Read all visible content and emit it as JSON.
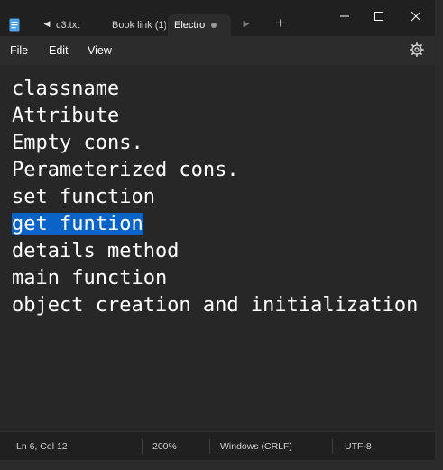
{
  "titlebar": {
    "app_icon": "notepad-icon",
    "tabs": [
      {
        "label": "c3.txt",
        "active": false
      },
      {
        "label": "Book link (1).",
        "active": false
      },
      {
        "label": "Electro",
        "active": true,
        "unsaved": true
      }
    ],
    "scroll_left_icon": "triangle-left-icon",
    "scroll_right_icon": "triangle-right-icon",
    "new_tab_label": "+",
    "window_controls": [
      "minimize-icon",
      "maximize-icon",
      "close-icon"
    ]
  },
  "menu": {
    "file": "File",
    "edit": "Edit",
    "view": "View",
    "settings_icon": "gear-icon"
  },
  "editor": {
    "lines": [
      "classname",
      "Attribute",
      "Empty cons.",
      "Perameterized cons.",
      "set function",
      "get funtion",
      "details method",
      "main function",
      "object creation and initialization"
    ],
    "selected_line": 6,
    "selection_color": "#0a64c8"
  },
  "status": {
    "position": "Ln 6, Col 12",
    "zoom": "200%",
    "line_ending": "Windows (CRLF)",
    "encoding": "UTF-8"
  },
  "colors": {
    "background": "#272727",
    "titlebar": "#202020",
    "text": "#ffffff",
    "accent": "#0a64c8"
  }
}
